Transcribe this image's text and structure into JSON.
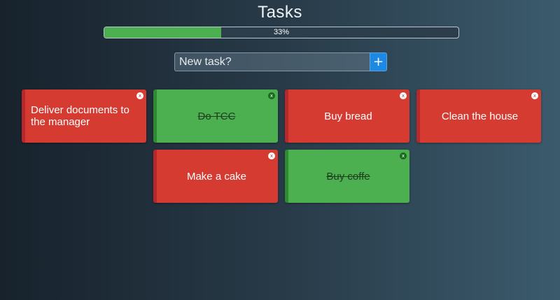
{
  "app": {
    "title": "Tasks"
  },
  "progress": {
    "percent": 33,
    "label": "33%"
  },
  "new_task": {
    "placeholder": "New task?",
    "value": "",
    "add_label": "+"
  },
  "colors": {
    "pending": "#d63b32",
    "done": "#4caf50",
    "add_button": "#1e88e5"
  },
  "tasks": [
    {
      "text": "Deliver documents to the manager",
      "done": false,
      "close": "x"
    },
    {
      "text": "Do TCC",
      "done": true,
      "close": "x"
    },
    {
      "text": "Buy bread",
      "done": false,
      "close": "x"
    },
    {
      "text": "Clean the house",
      "done": false,
      "close": "x"
    },
    {
      "text": "Make a cake",
      "done": false,
      "close": "x"
    },
    {
      "text": "Buy coffe",
      "done": true,
      "close": "x"
    }
  ]
}
